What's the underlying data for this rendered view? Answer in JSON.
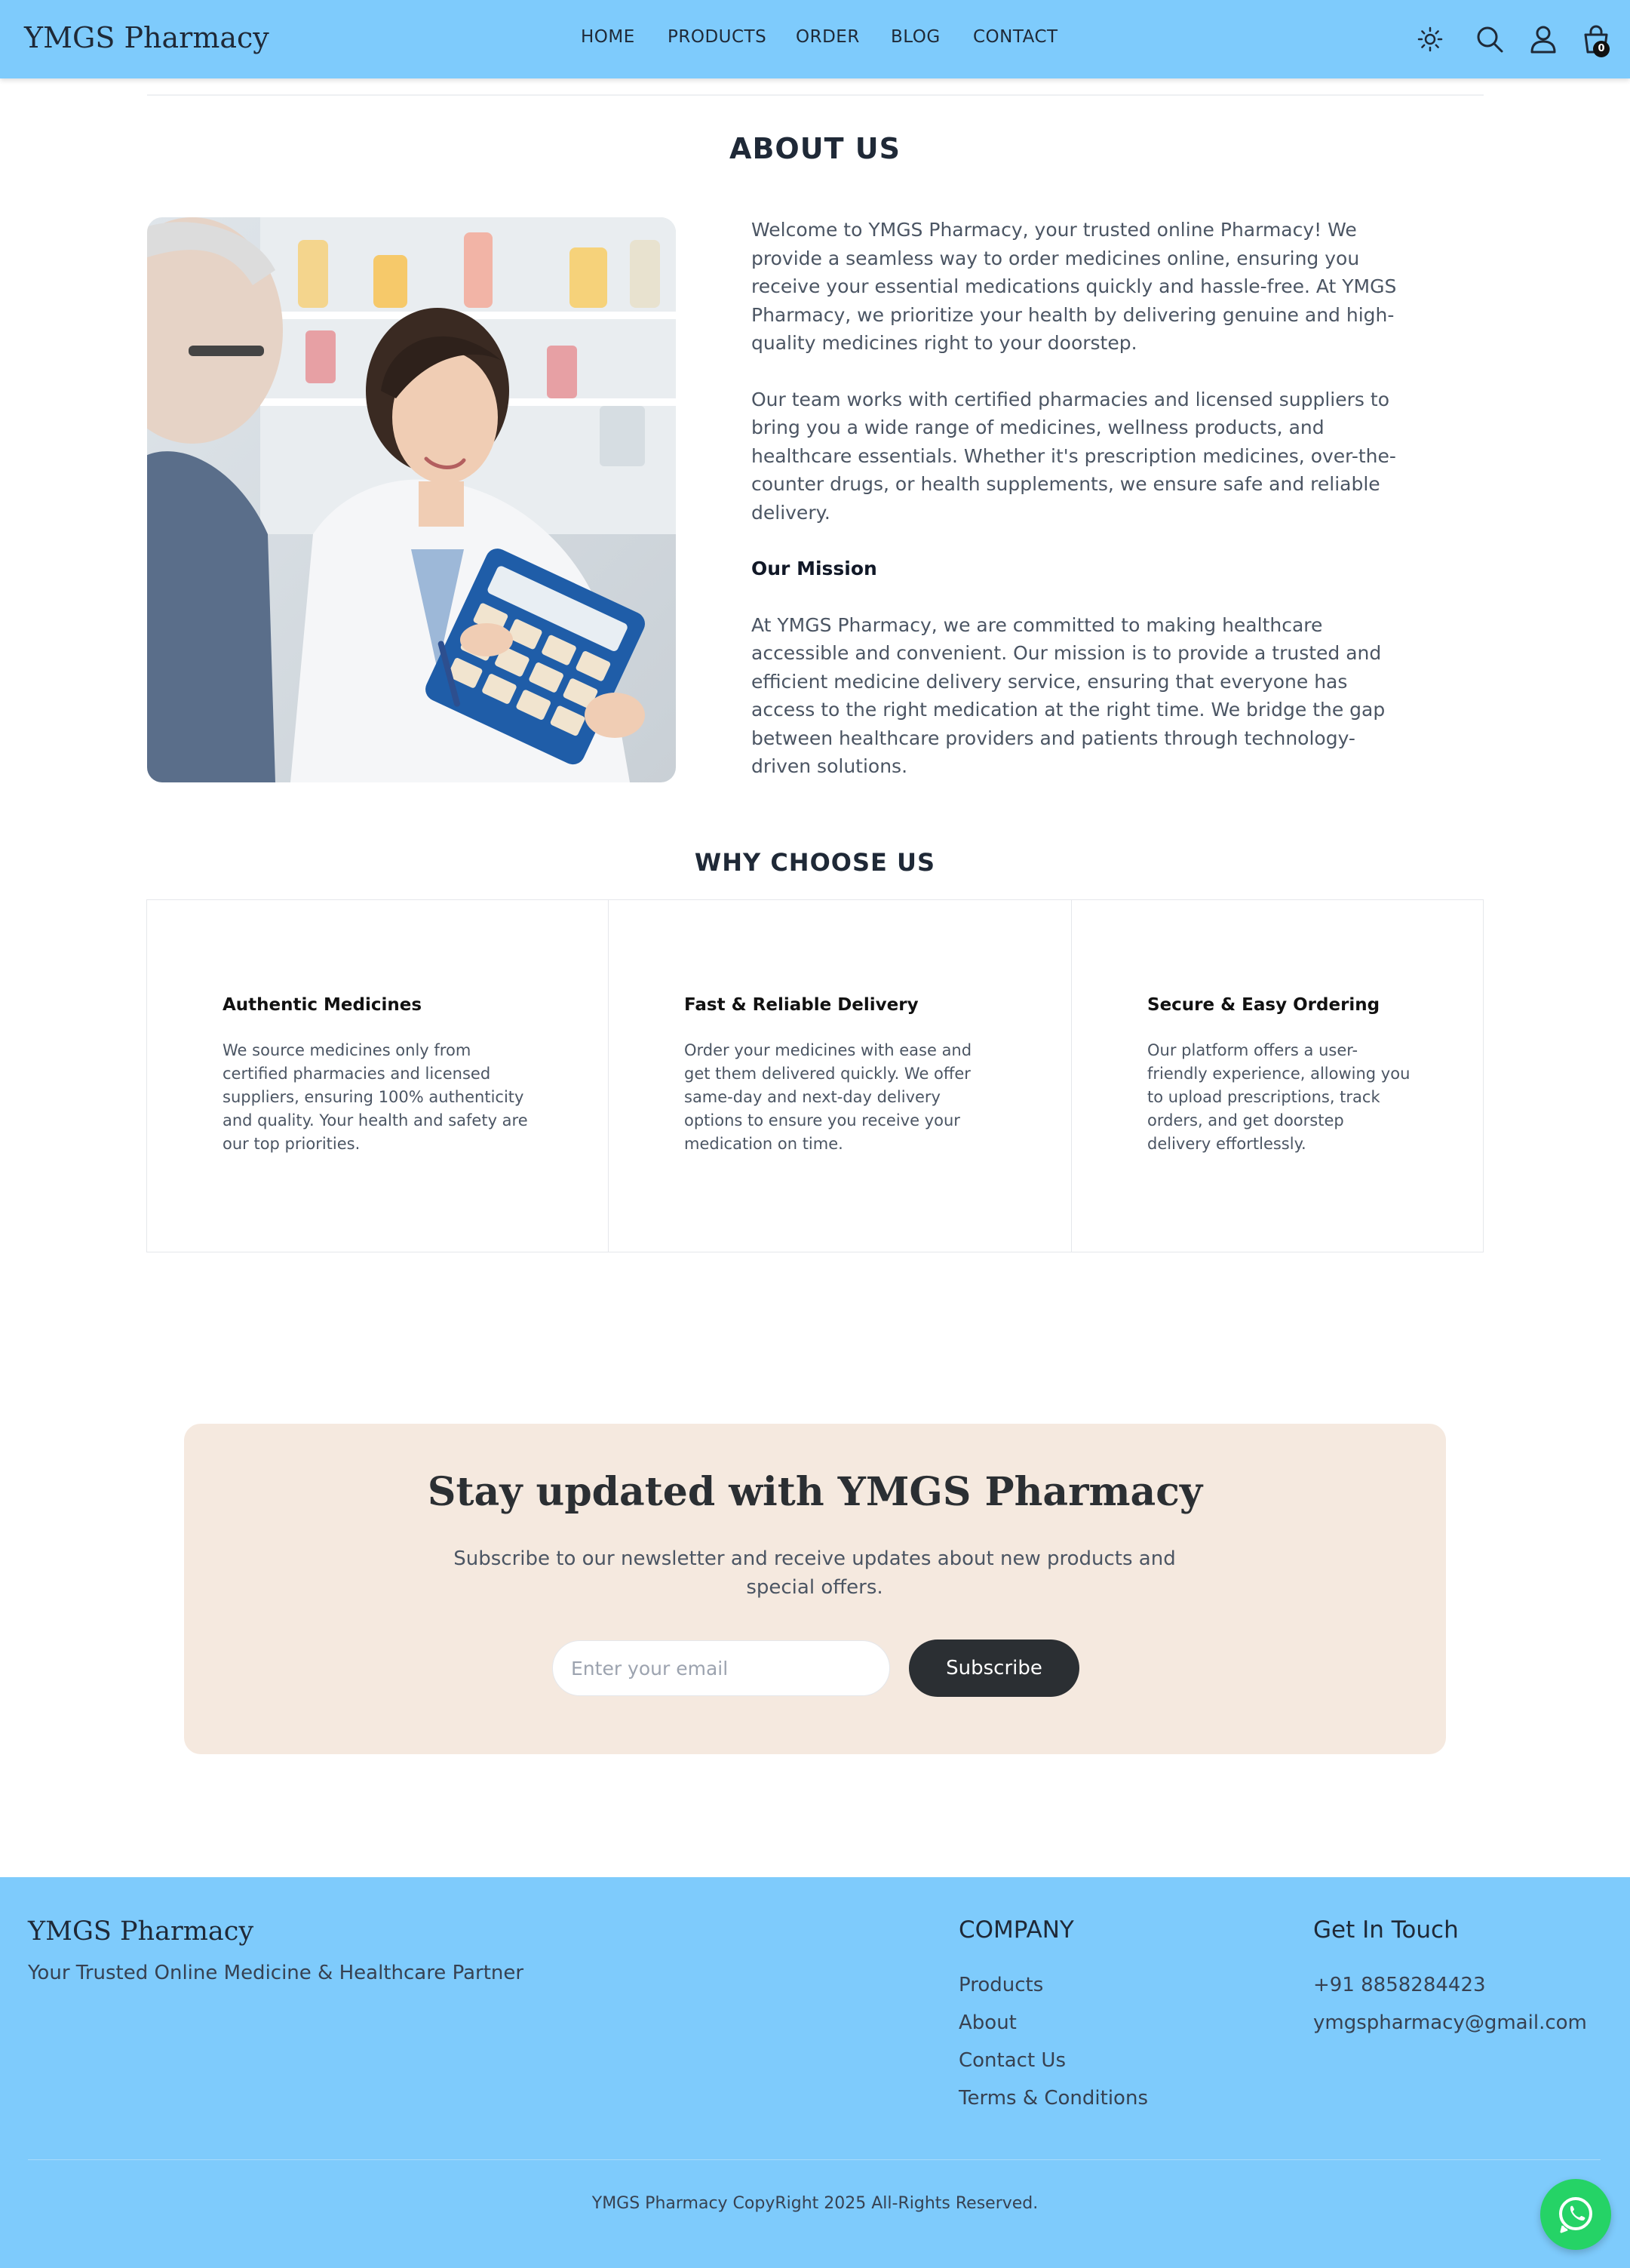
{
  "nav": {
    "brand": "YMGS Pharmacy",
    "links": [
      "HOME",
      "PRODUCTS",
      "ORDER",
      "BLOG",
      "CONTACT"
    ],
    "icons": [
      "sun-icon",
      "search-icon",
      "user-icon",
      "cart-icon"
    ],
    "cart_count": "0"
  },
  "about": {
    "title": "ABOUT US",
    "paragraph1": "Welcome to YMGS Pharmacy, your trusted online Pharmacy! We provide a seamless way to order medicines online, ensuring you receive your essential medications quickly and hassle-free. At YMGS Pharmacy, we prioritize your health by delivering genuine and high-quality medicines right to your doorstep.",
    "paragraph2": "Our team works with certified pharmacies and licensed suppliers to bring you a wide range of medicines, wellness products, and healthcare essentials. Whether it's prescription medicines, over-the-counter drugs, or health supplements, we ensure safe and reliable delivery.",
    "mission_title": "Our Mission",
    "mission_text": "At YMGS Pharmacy, we are committed to making healthcare accessible and convenient. Our mission is to provide a trusted and efficient medicine delivery service, ensuring that everyone has access to the right medication at the right time. We bridge the gap between healthcare providers and patients through technology-driven solutions."
  },
  "why": {
    "title": "WHY CHOOSE US",
    "cards": [
      {
        "title": "Authentic Medicines",
        "text": "We source medicines only from certified pharmacies and licensed suppliers, ensuring 100% authenticity and quality. Your health and safety are our top priorities."
      },
      {
        "title": "Fast & Reliable Delivery",
        "text": "Order your medicines with ease and get them delivered quickly. We offer same-day and next-day delivery options to ensure you receive your medication on time."
      },
      {
        "title": "Secure & Easy Ordering",
        "text": "Our platform offers a user-friendly experience, allowing you to upload prescriptions, track orders, and get doorstep delivery effortlessly."
      }
    ]
  },
  "newsletter": {
    "title": "Stay updated with YMGS Pharmacy",
    "subtitle": "Subscribe to our newsletter and receive updates about new products and special offers.",
    "email_placeholder": "Enter your email",
    "email_value": "",
    "button_label": "Subscribe"
  },
  "footer": {
    "brand": "YMGS Pharmacy",
    "tagline": "Your Trusted Online Medicine & Healthcare Partner",
    "company_title": "COMPANY",
    "company_links": [
      "Products",
      "About",
      "Contact Us",
      "Terms & Conditions"
    ],
    "contact_title": "Get In Touch",
    "phone": "+91 8858284423",
    "email": "ymgspharmacy@gmail.com",
    "copyright": "YMGS Pharmacy CopyRight 2025 All-Rights Reserved."
  },
  "colors": {
    "nav_bg": "#7ecbfc",
    "footer_bg": "#7ecbfc",
    "newsletter_bg": "#f5e9df",
    "button_dark": "#2b2f33",
    "whatsapp_green": "#25d366"
  }
}
